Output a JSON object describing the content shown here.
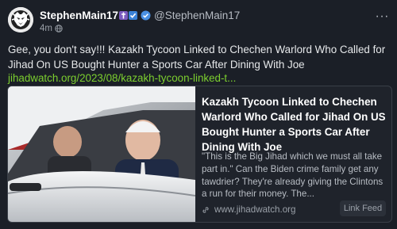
{
  "author": {
    "display_name": "StephenMain17",
    "handle": "@StephenMain17",
    "badges": [
      "cross-badge",
      "check-badge"
    ],
    "verified_icon": "verified-badge-icon"
  },
  "post": {
    "time": "4m",
    "visibility_icon": "globe-icon",
    "more_label": "···",
    "text": "Gee, you don't say!!! Kazakh Tycoon Linked to Chechen Warlord Who Called for Jihad On US Bought Hunter a Sports Car After Dining With Joe",
    "link_text": "jihadwatch.org/2023/08/kazakh-tycoon-linked-t..."
  },
  "card": {
    "title": "Kazakh Tycoon Linked to Chechen Warlord Who Called for Jihad On US Bought Hunter a Sports Car After Dining With Joe",
    "description": "\"This is the Big Jihad which we must all take part in.\" Can the Biden crime family get any tawdrier? They're already giving the Clintons a run for their money. The...",
    "domain": "www.jihadwatch.org",
    "link_feed_label": "Link Feed"
  },
  "colors": {
    "background": "#1b1f27",
    "link_green": "#7ccf2f",
    "verified_blue": "#4a90e2"
  }
}
